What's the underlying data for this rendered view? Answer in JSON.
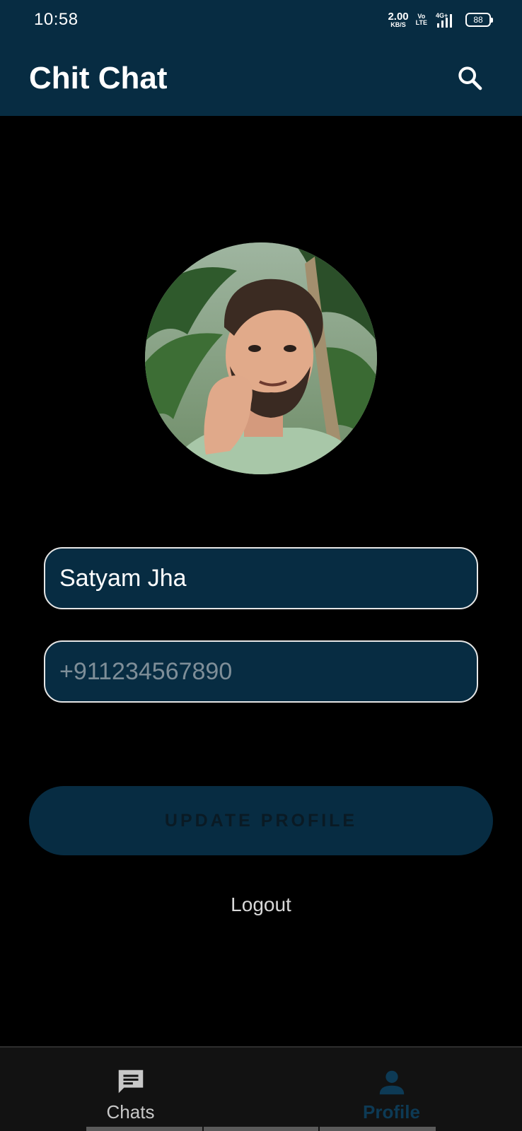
{
  "status_bar": {
    "time": "10:58",
    "net_speed_value": "2.00",
    "net_speed_unit": "KB/S",
    "volte_top": "Vo",
    "volte_bottom": "LTE",
    "network": "4G+",
    "battery": "88"
  },
  "app_bar": {
    "title": "Chit Chat",
    "search_icon": "search-icon"
  },
  "profile": {
    "avatar_alt": "profile-photo",
    "name_value": "Satyam Jha",
    "phone_placeholder": "+911234567890",
    "update_button_label": "UPDATE PROFILE",
    "logout_label": "Logout"
  },
  "bottom_nav": {
    "items": [
      {
        "label": "Chats",
        "icon": "chat-icon",
        "active": false
      },
      {
        "label": "Profile",
        "icon": "person-icon",
        "active": true
      }
    ]
  },
  "colors": {
    "primary": "#072c42",
    "background": "#000000",
    "nav_background": "#121212",
    "active_tab": "#0d3a55",
    "text": "#ffffff"
  }
}
